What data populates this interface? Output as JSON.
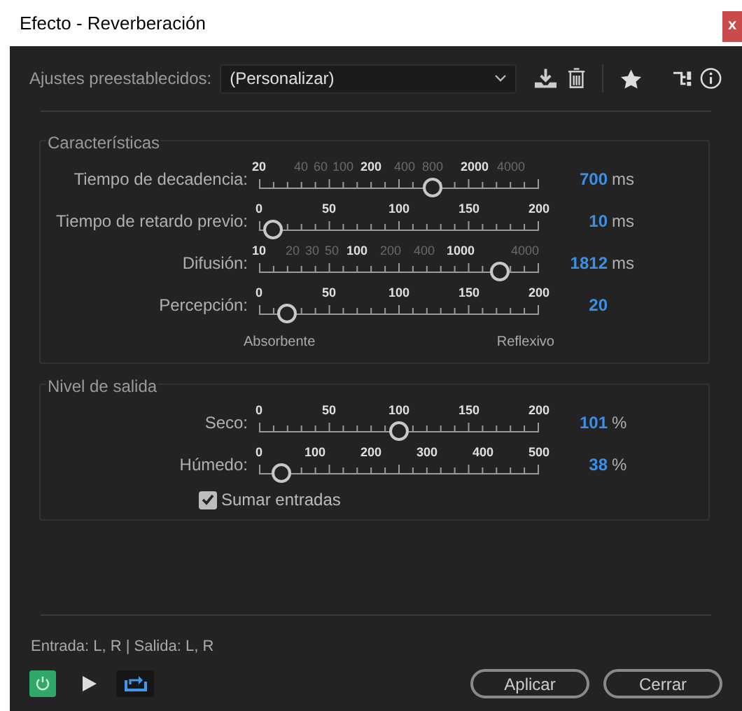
{
  "window": {
    "title": "Efecto - Reverberación",
    "close": "x"
  },
  "presets": {
    "label": "Ajustes preestablecidos:",
    "value": "(Personalizar)"
  },
  "groups": [
    {
      "title": "Características",
      "sliders": [
        {
          "kind": "log",
          "label": "Tiempo de decadencia:",
          "level": 0.62,
          "value": "700",
          "unit": "ms",
          "ticks": [
            {
              "text": "20",
              "bold": true
            },
            {
              "text": "40",
              "bold": false
            },
            {
              "text": "60",
              "bold": false
            },
            {
              "text": "100",
              "bold": false
            },
            {
              "text": "200",
              "bold": true
            },
            {
              "text": "400",
              "bold": false
            },
            {
              "text": "800",
              "bold": false
            },
            {
              "text": "2000",
              "bold": true
            },
            {
              "text": "4000",
              "bold": false
            }
          ]
        },
        {
          "kind": "linear",
          "label": "Tiempo de retardo previo:",
          "level": 0.05,
          "value": "10",
          "unit": "ms",
          "ticks": [
            {
              "text": "0",
              "bold": true
            },
            {
              "text": "50",
              "bold": true
            },
            {
              "text": "100",
              "bold": true
            },
            {
              "text": "150",
              "bold": true
            },
            {
              "text": "200",
              "bold": true
            }
          ]
        },
        {
          "kind": "log",
          "label": "Difusión:",
          "level": 0.86,
          "value": "1812",
          "unit": "ms",
          "ticks": [
            {
              "text": "10",
              "bold": true
            },
            {
              "text": "20",
              "bold": false
            },
            {
              "text": "30",
              "bold": false
            },
            {
              "text": "50",
              "bold": false
            },
            {
              "text": "100",
              "bold": true
            },
            {
              "text": "200",
              "bold": false
            },
            {
              "text": "400",
              "bold": false
            },
            {
              "text": "1000",
              "bold": true
            },
            {
              "text": "4000",
              "bold": false
            }
          ]
        },
        {
          "kind": "linear",
          "label": "Percepción:",
          "level": 0.1,
          "value": "20",
          "ticks": [
            {
              "text": "0",
              "bold": true
            },
            {
              "text": "50",
              "bold": true
            },
            {
              "text": "100",
              "bold": true
            },
            {
              "text": "150",
              "bold": true
            },
            {
              "text": "200",
              "bold": true
            }
          ]
        }
      ],
      "ends": [
        "Absorbente",
        "Reflexivo"
      ]
    },
    {
      "title": "Nivel de salida",
      "sliders": [
        {
          "kind": "linear",
          "label": "Seco:",
          "level": 0.5,
          "value": "101",
          "unit": "%",
          "ticks": [
            {
              "text": "0",
              "bold": true
            },
            {
              "text": "50",
              "bold": true
            },
            {
              "text": "100",
              "bold": true
            },
            {
              "text": "150",
              "bold": true
            },
            {
              "text": "200",
              "bold": true
            }
          ]
        },
        {
          "kind": "linear",
          "label": "Húmedo:",
          "level": 0.08,
          "value": "38",
          "unit": "%",
          "ticks": [
            {
              "text": "0",
              "bold": true
            },
            {
              "text": "100",
              "bold": true
            },
            {
              "text": "200",
              "bold": true
            },
            {
              "text": "300",
              "bold": true
            },
            {
              "text": "400",
              "bold": true
            },
            {
              "text": "500",
              "bold": true
            }
          ]
        }
      ],
      "checkbox": {
        "label": "Sumar entradas",
        "checked": true
      }
    }
  ],
  "routing": "Entrada: L, R | Salida: L, R",
  "power": {
    "on": true
  },
  "buttons": [
    "Aplicar",
    "Cerrar"
  ]
}
